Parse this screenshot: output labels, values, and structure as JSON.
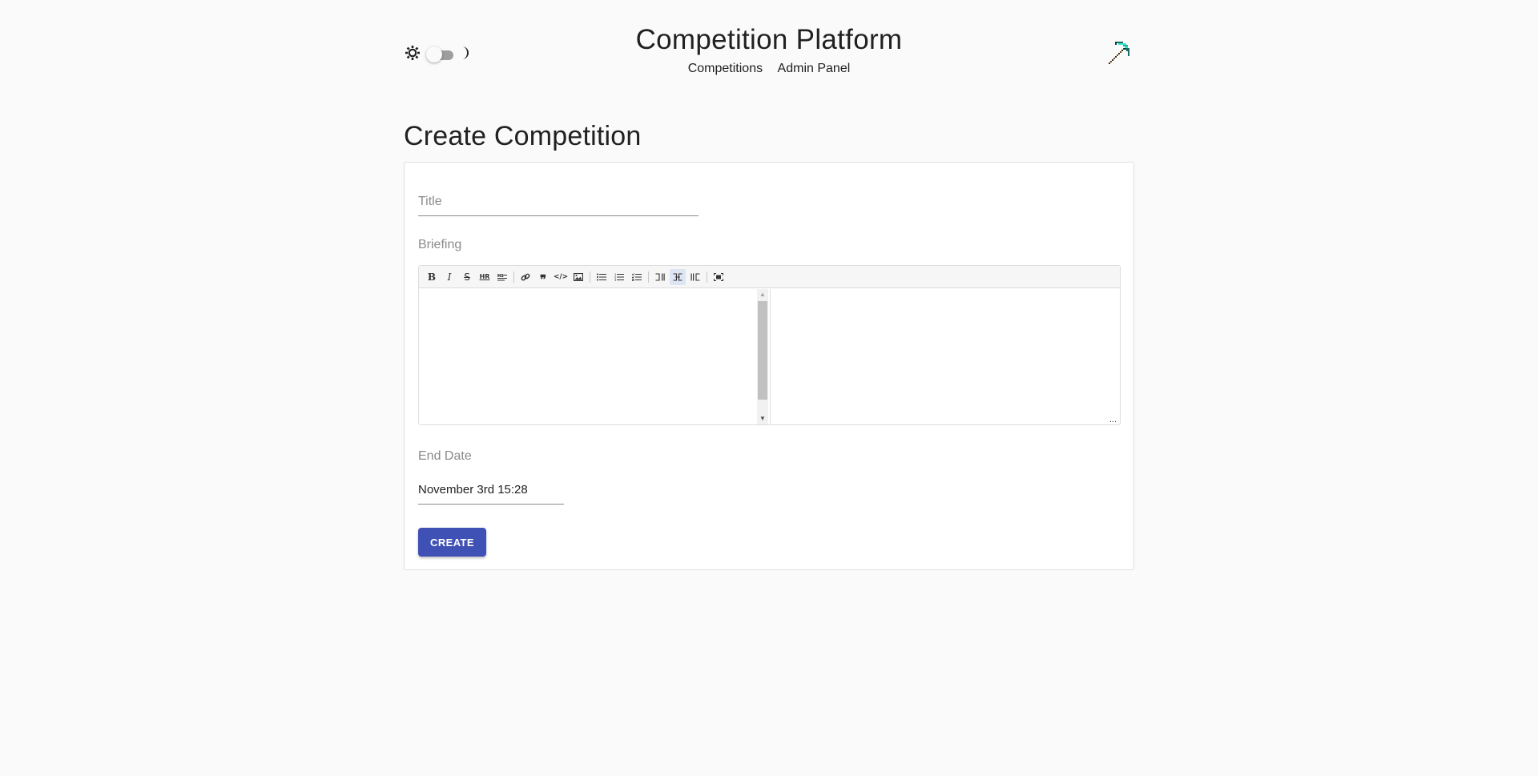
{
  "header": {
    "title": "Competition Platform",
    "nav": {
      "competitions": "Competitions",
      "admin_panel": "Admin Panel"
    },
    "theme_toggle": {
      "state": "light",
      "sun_icon": "sun-icon",
      "moon_icon": "moon-icon"
    },
    "logo_icon": "pickaxe-icon"
  },
  "page": {
    "title": "Create Competition"
  },
  "form": {
    "title_placeholder": "Title",
    "title_value": "",
    "briefing_label": "Briefing",
    "briefing_value": "",
    "toolbar": [
      {
        "name": "bold-icon",
        "glyph": "B"
      },
      {
        "name": "italic-icon",
        "glyph": "I"
      },
      {
        "name": "strikethrough-icon",
        "glyph": "S"
      },
      {
        "name": "horizontal-rule-icon",
        "glyph": "HR"
      },
      {
        "name": "heading-icon",
        "glyph": "H"
      },
      {
        "name": "link-icon",
        "glyph": "🔗"
      },
      {
        "name": "quote-icon",
        "glyph": "99"
      },
      {
        "name": "code-icon",
        "glyph": "</>"
      },
      {
        "name": "image-icon",
        "glyph": "img"
      },
      {
        "name": "unordered-list-icon",
        "glyph": "≡"
      },
      {
        "name": "ordered-list-icon",
        "glyph": "1≡"
      },
      {
        "name": "checklist-icon",
        "glyph": "☑"
      },
      {
        "name": "edit-mode-icon",
        "glyph": "⊐"
      },
      {
        "name": "live-mode-icon",
        "glyph": "⌶",
        "active": true
      },
      {
        "name": "preview-mode-icon",
        "glyph": "⊏"
      },
      {
        "name": "fullscreen-icon",
        "glyph": "⛶"
      }
    ],
    "preview_dots": "...",
    "end_date_label": "End Date",
    "end_date_value": "November 3rd 15:28",
    "create_label": "CREATE"
  },
  "colors": {
    "background": "#fafafa",
    "primary": "#3f51b5",
    "card": "#ffffff",
    "label": "#8a8a8a"
  }
}
